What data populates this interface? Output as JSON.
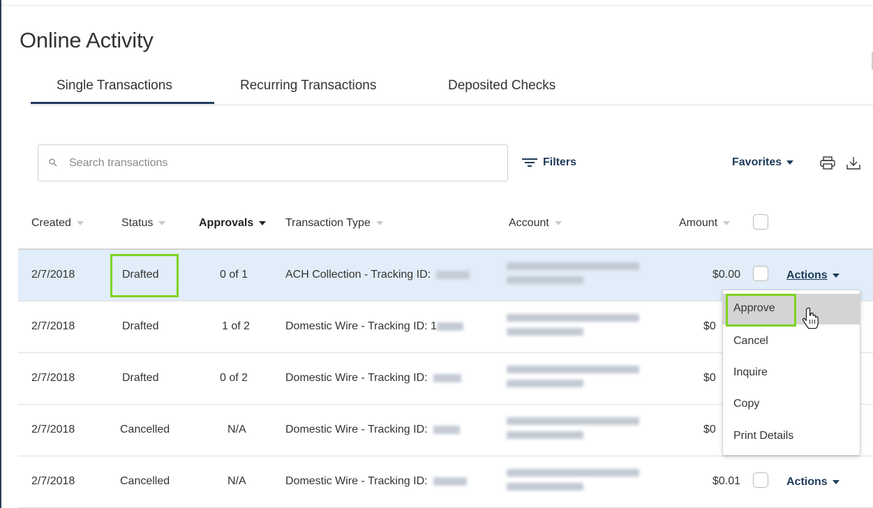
{
  "page": {
    "title": "Online Activity"
  },
  "tabs": [
    {
      "label": "Single Transactions",
      "active": true
    },
    {
      "label": "Recurring Transactions",
      "active": false
    },
    {
      "label": "Deposited Checks",
      "active": false
    }
  ],
  "toolbar": {
    "search_placeholder": "Search transactions",
    "filters_label": "Filters",
    "favorites_label": "Favorites"
  },
  "table": {
    "columns": [
      "Created",
      "Status",
      "Approvals",
      "Transaction Type",
      "Account",
      "Amount"
    ],
    "rows": [
      {
        "created": "2/7/2018",
        "status": "Drafted",
        "approvals": "0 of 1",
        "type": "ACH Collection - Tracking ID:",
        "amount": "$0.00",
        "actions": "Actions"
      },
      {
        "created": "2/7/2018",
        "status": "Drafted",
        "approvals": "1 of 2",
        "type": "Domestic Wire - Tracking ID: 1",
        "amount": "$0",
        "actions": ""
      },
      {
        "created": "2/7/2018",
        "status": "Drafted",
        "approvals": "0 of 2",
        "type": "Domestic Wire - Tracking ID:",
        "amount": "$0",
        "actions": ""
      },
      {
        "created": "2/7/2018",
        "status": "Cancelled",
        "approvals": "N/A",
        "type": "Domestic Wire - Tracking ID:",
        "amount": "$0",
        "actions": ""
      },
      {
        "created": "2/7/2018",
        "status": "Cancelled",
        "approvals": "N/A",
        "type": "Domestic Wire - Tracking ID:",
        "amount": "$0.01",
        "actions": "Actions"
      }
    ]
  },
  "actions_menu": {
    "items": [
      "Approve",
      "Cancel",
      "Inquire",
      "Copy",
      "Print Details"
    ],
    "hovered": "Approve"
  },
  "colors": {
    "accent": "#1d3a5a",
    "highlight": "#7ed321",
    "selected_row": "#e1edf8"
  }
}
